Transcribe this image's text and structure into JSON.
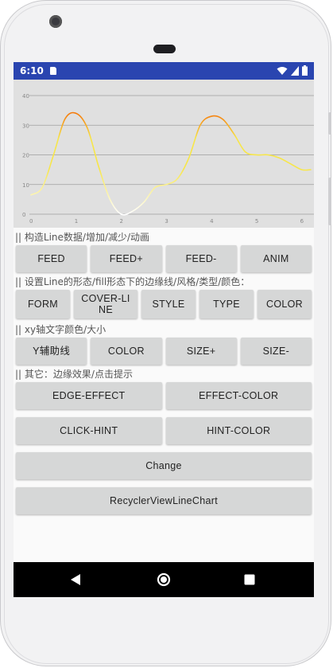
{
  "status_bar": {
    "time": "6:10"
  },
  "chart_data": {
    "type": "line",
    "x_ticks": [
      "0",
      "1",
      "2",
      "3",
      "4",
      "5",
      "6"
    ],
    "y_ticks": [
      "0",
      "10",
      "20",
      "30",
      "40"
    ],
    "ylim": [
      0,
      40
    ],
    "xlim": [
      0,
      6.2
    ],
    "series": [
      {
        "x": [
          0,
          0.25,
          0.5,
          0.75,
          1.0,
          1.25,
          1.5,
          1.75,
          2.0,
          2.25,
          2.5,
          2.75,
          3.0,
          3.25,
          3.5,
          3.75,
          4.0,
          4.25,
          4.5,
          4.75,
          5.0,
          5.25,
          5.5,
          5.75,
          6.0,
          6.2
        ],
        "y": [
          6.5,
          9,
          20,
          32,
          34,
          29,
          16,
          5,
          0,
          1,
          4,
          9,
          10,
          12,
          19,
          30,
          33,
          32,
          27,
          21,
          20,
          20,
          19,
          17,
          15,
          15
        ]
      }
    ],
    "line_colors": {
      "low": "#ffffff",
      "mid": "#f7e64a",
      "high": "#f57a0a"
    }
  },
  "sections": [
    {
      "title": "|| 构造Line数据/增加/减少/动画",
      "rows": [
        [
          "FEED",
          "FEED+",
          "FEED-",
          "ANIM"
        ]
      ]
    },
    {
      "title": "|| 设置Line的形态/fill形态下的边缘线/风格/类型/颜色：",
      "rows": [
        [
          "FORM",
          "COVER-LINE",
          "STYLE",
          "TYPE",
          "COLOR"
        ]
      ]
    },
    {
      "title": "|| xy轴文字颜色/大小",
      "rows": [
        [
          "Y辅助线",
          "COLOR",
          "SIZE+",
          "SIZE-"
        ]
      ]
    },
    {
      "title": "|| 其它：边缘效果/点击提示",
      "rows": [
        [
          "EDGE-EFFECT",
          "EFFECT-COLOR"
        ],
        [
          "CLICK-HINT",
          "HINT-COLOR"
        ],
        [
          "Change"
        ],
        [
          "RecyclerViewLineChart"
        ]
      ]
    }
  ]
}
